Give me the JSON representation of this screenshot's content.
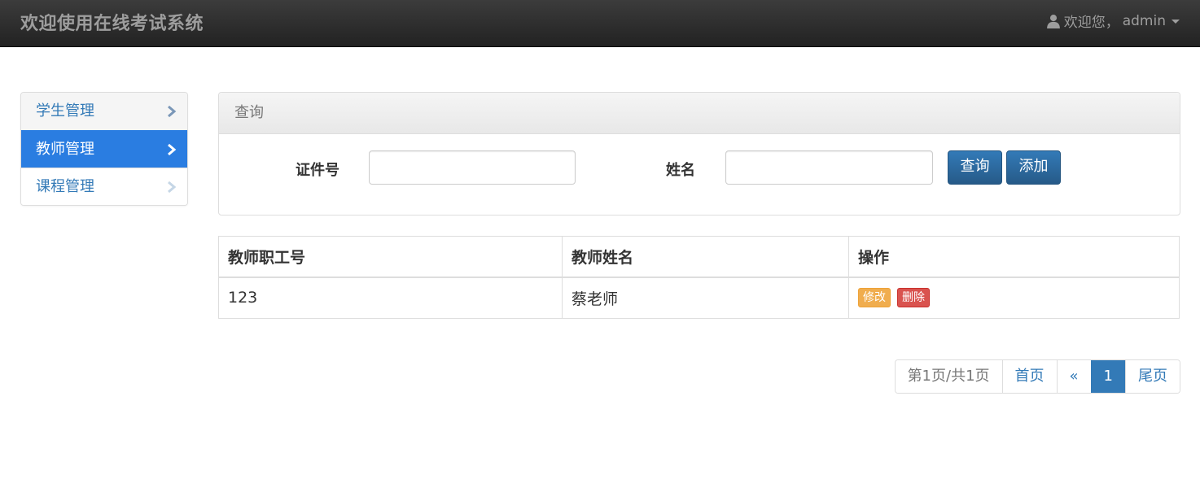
{
  "navbar": {
    "brand": "欢迎使用在线考试系统",
    "greeting": "欢迎您，",
    "username": "admin"
  },
  "sidebar": {
    "items": [
      {
        "label": "学生管理"
      },
      {
        "label": "教师管理"
      },
      {
        "label": "课程管理"
      }
    ],
    "active_index": 1
  },
  "query_panel": {
    "title": "查询",
    "id_label": "证件号",
    "id_value": "",
    "name_label": "姓名",
    "name_value": "",
    "search_button": "查询",
    "add_button": "添加"
  },
  "table": {
    "headers": [
      "教师职工号",
      "教师姓名",
      "操作"
    ],
    "rows": [
      {
        "id": "123",
        "name": "蔡老师",
        "edit_label": "修改",
        "delete_label": "删除"
      }
    ]
  },
  "pagination": {
    "info": "第1页/共1页",
    "first": "首页",
    "prev": "«",
    "current": "1",
    "last": "尾页"
  },
  "colors": {
    "primary": "#337ab7",
    "active_sidebar": "#2a7de1",
    "warning": "#f0ad4e",
    "danger": "#d9534f"
  }
}
